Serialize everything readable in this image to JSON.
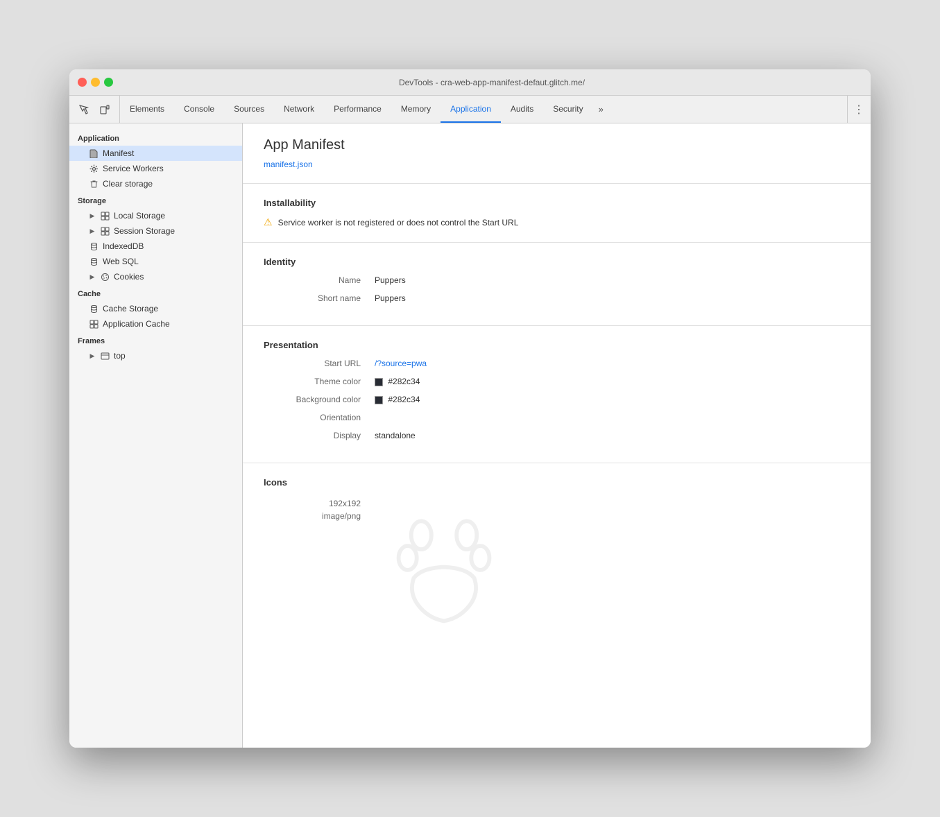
{
  "window": {
    "title": "DevTools - cra-web-app-manifest-defaut.glitch.me/"
  },
  "toolbar": {
    "inspect_label": "⬚",
    "device_label": "⬜",
    "tabs": [
      {
        "id": "elements",
        "label": "Elements",
        "active": false
      },
      {
        "id": "console",
        "label": "Console",
        "active": false
      },
      {
        "id": "sources",
        "label": "Sources",
        "active": false
      },
      {
        "id": "network",
        "label": "Network",
        "active": false
      },
      {
        "id": "performance",
        "label": "Performance",
        "active": false
      },
      {
        "id": "memory",
        "label": "Memory",
        "active": false
      },
      {
        "id": "application",
        "label": "Application",
        "active": true
      },
      {
        "id": "audits",
        "label": "Audits",
        "active": false
      },
      {
        "id": "security",
        "label": "Security",
        "active": false
      }
    ],
    "more_label": "»",
    "menu_label": "⋮"
  },
  "sidebar": {
    "sections": [
      {
        "id": "application",
        "title": "Application",
        "items": [
          {
            "id": "manifest",
            "label": "Manifest",
            "icon": "file",
            "active": true,
            "indent": 1
          },
          {
            "id": "service-workers",
            "label": "Service Workers",
            "icon": "gear",
            "active": false,
            "indent": 1
          },
          {
            "id": "clear-storage",
            "label": "Clear storage",
            "icon": "trash",
            "active": false,
            "indent": 1
          }
        ]
      },
      {
        "id": "storage",
        "title": "Storage",
        "items": [
          {
            "id": "local-storage",
            "label": "Local Storage",
            "icon": "grid",
            "active": false,
            "indent": 1,
            "expandable": true
          },
          {
            "id": "session-storage",
            "label": "Session Storage",
            "icon": "grid",
            "active": false,
            "indent": 1,
            "expandable": true
          },
          {
            "id": "indexeddb",
            "label": "IndexedDB",
            "icon": "db",
            "active": false,
            "indent": 1
          },
          {
            "id": "web-sql",
            "label": "Web SQL",
            "icon": "db",
            "active": false,
            "indent": 1
          },
          {
            "id": "cookies",
            "label": "Cookies",
            "icon": "cookie",
            "active": false,
            "indent": 1,
            "expandable": true
          }
        ]
      },
      {
        "id": "cache",
        "title": "Cache",
        "items": [
          {
            "id": "cache-storage",
            "label": "Cache Storage",
            "icon": "db",
            "active": false,
            "indent": 1
          },
          {
            "id": "application-cache",
            "label": "Application Cache",
            "icon": "grid",
            "active": false,
            "indent": 1
          }
        ]
      },
      {
        "id": "frames",
        "title": "Frames",
        "items": [
          {
            "id": "top",
            "label": "top",
            "icon": "frame",
            "active": false,
            "indent": 1,
            "expandable": true
          }
        ]
      }
    ]
  },
  "content": {
    "page_title": "App Manifest",
    "manifest_link": "manifest.json",
    "installability": {
      "heading": "Installability",
      "warning_text": "Service worker is not registered or does not control the Start URL"
    },
    "identity": {
      "heading": "Identity",
      "fields": [
        {
          "label": "Name",
          "value": "Puppers"
        },
        {
          "label": "Short name",
          "value": "Puppers"
        }
      ]
    },
    "presentation": {
      "heading": "Presentation",
      "fields": [
        {
          "label": "Start URL",
          "value": "/?source=pwa",
          "is_link": true
        },
        {
          "label": "Theme color",
          "value": "#282c34",
          "has_swatch": true
        },
        {
          "label": "Background color",
          "value": "#282c34",
          "has_swatch": true
        },
        {
          "label": "Orientation",
          "value": ""
        },
        {
          "label": "Display",
          "value": "standalone"
        }
      ]
    },
    "icons": {
      "heading": "Icons",
      "size": "192x192",
      "type": "image/png"
    }
  }
}
